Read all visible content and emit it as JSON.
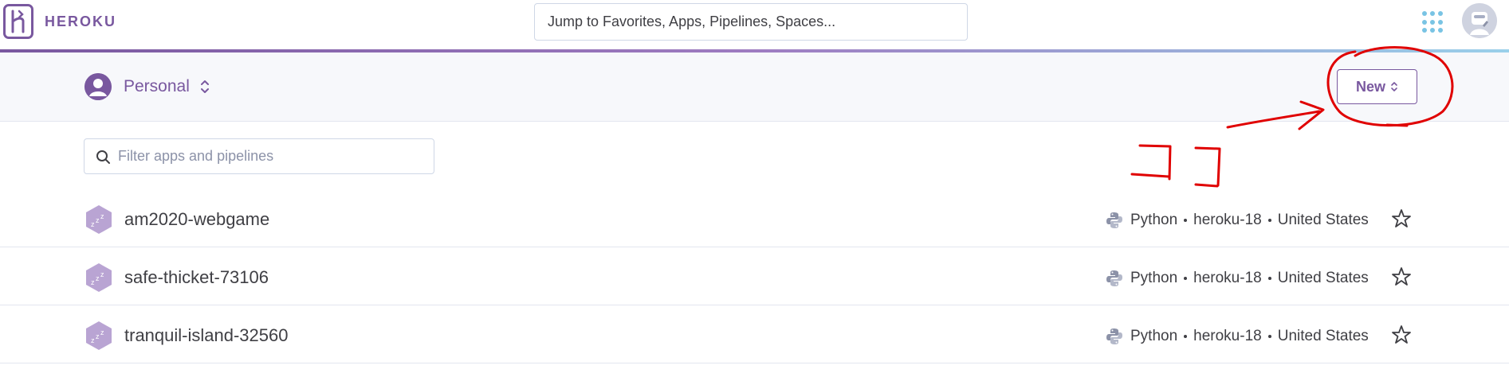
{
  "topnav": {
    "brand": "HEROKU",
    "search_placeholder": "Jump to Favorites, Apps, Pipelines, Spaces...",
    "apps_icon": "apps-grid-icon",
    "avatar_icon": "user-avatar-icon"
  },
  "subheader": {
    "account_label": "Personal",
    "new_label": "New"
  },
  "filter": {
    "placeholder": "Filter apps and pipelines"
  },
  "apps": [
    {
      "name": "am2020-webgame",
      "language": "Python",
      "stack": "heroku-18",
      "region": "United States"
    },
    {
      "name": "safe-thicket-73106",
      "language": "Python",
      "stack": "heroku-18",
      "region": "United States"
    },
    {
      "name": "tranquil-island-32560",
      "language": "Python",
      "stack": "heroku-18",
      "region": "United States"
    }
  ],
  "annotation": {
    "text": "ココ",
    "color": "#e00000"
  },
  "colors": {
    "brand": "#79589f",
    "text": "#3f3f44",
    "subheader_bg": "#f7f8fb",
    "app_icon": "#b9a4d3"
  }
}
